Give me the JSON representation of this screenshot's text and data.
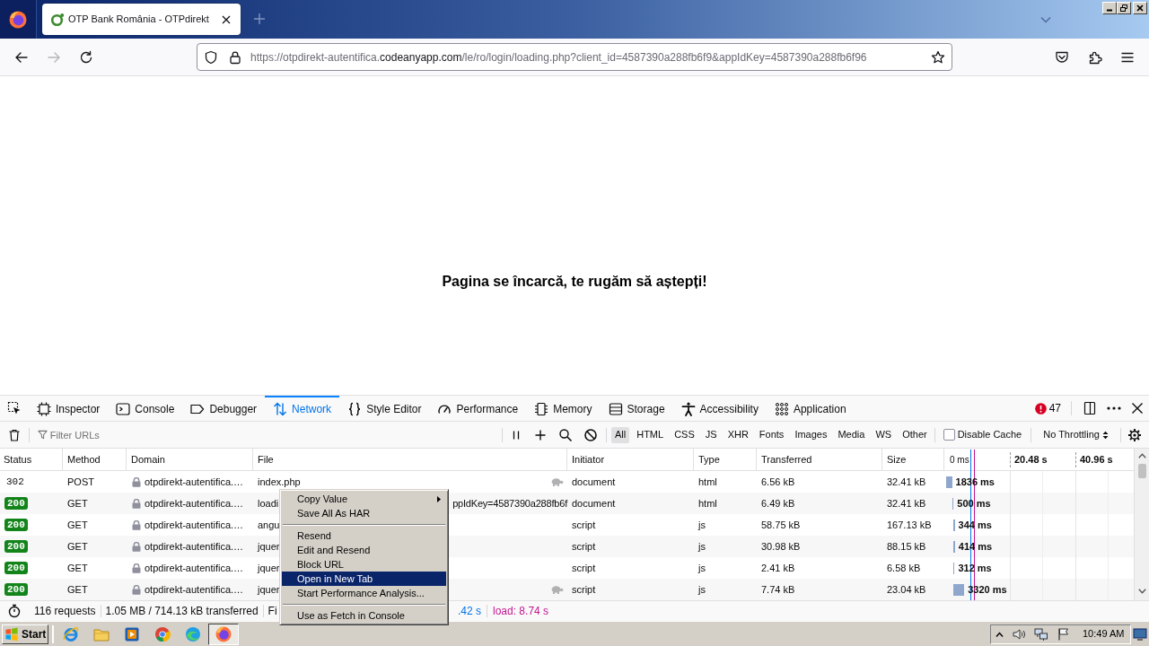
{
  "browser": {
    "tabs": [
      {
        "title": "OTP Bank România - OTPdirekt",
        "selected": true
      }
    ],
    "nav_buttons": [
      {
        "disabled": false
      },
      {
        "disabled": true
      },
      {
        "disabled": false
      }
    ],
    "url_parts": [
      {
        "text": "https://otpdirekt-autentifica.",
        "host": false
      },
      {
        "text": "codeanyapp.com",
        "host": true
      },
      {
        "text": "/le/ro/login/loading.php?client_id=4587390a288fb6f9&appIdKey=4587390a288fb6f96",
        "host": false
      }
    ]
  },
  "page": {
    "message": "Pagina se încarcă, te rugăm să aștepți!"
  },
  "devtools": {
    "tabs": [
      {
        "label": "Inspector",
        "selected": false
      },
      {
        "label": "Console",
        "selected": false
      },
      {
        "label": "Debugger",
        "selected": false
      },
      {
        "label": "Network",
        "selected": true
      },
      {
        "label": "Style Editor",
        "selected": false
      },
      {
        "label": "Performance",
        "selected": false
      },
      {
        "label": "Memory",
        "selected": false
      },
      {
        "label": "Storage",
        "selected": false
      },
      {
        "label": "Accessibility",
        "selected": false
      },
      {
        "label": "Application",
        "selected": false
      }
    ],
    "error_count": "47",
    "filter": {
      "placeholder": "Filter URLs"
    },
    "type_filters": [
      {
        "label": "All",
        "selected": true
      },
      {
        "label": "HTML",
        "selected": false
      },
      {
        "label": "CSS",
        "selected": false
      },
      {
        "label": "JS",
        "selected": false
      },
      {
        "label": "XHR",
        "selected": false
      },
      {
        "label": "Fonts",
        "selected": false
      },
      {
        "label": "Images",
        "selected": false
      },
      {
        "label": "Media",
        "selected": false
      },
      {
        "label": "WS",
        "selected": false
      },
      {
        "label": "Other",
        "selected": false
      }
    ],
    "disable_cache": {
      "label": "Disable Cache",
      "checked": false
    },
    "throttling": "No Throttling",
    "columns": [
      "Status",
      "Method",
      "Domain",
      "File",
      "Initiator",
      "Type",
      "Transferred",
      "Size"
    ],
    "waterfall_ticks": [
      "0 ms",
      "20.48 s",
      "40.96 s"
    ],
    "rows": [
      {
        "status": "302",
        "badge": false,
        "method": "POST",
        "domain": "otpdirekt-autentifica.…",
        "file": [
          "index.php"
        ],
        "slow": true,
        "initiator": "document",
        "type": "html",
        "transferred": "6.56 kB",
        "size": "32.41 kB",
        "time": "1836 ms"
      },
      {
        "status": "200",
        "badge": true,
        "method": "GET",
        "domain": "otpdirekt-autentifica.…",
        "file": [
          "loadi",
          "ppIdKey=4587390a288fb6f"
        ],
        "slow": false,
        "initiator": "document",
        "type": "html",
        "transferred": "6.49 kB",
        "size": "32.41 kB",
        "time": "500 ms"
      },
      {
        "status": "200",
        "badge": true,
        "method": "GET",
        "domain": "otpdirekt-autentifica.…",
        "file": [
          "angu"
        ],
        "slow": false,
        "initiator": "script",
        "type": "js",
        "transferred": "58.75 kB",
        "size": "167.13 kB",
        "time": "344 ms"
      },
      {
        "status": "200",
        "badge": true,
        "method": "GET",
        "domain": "otpdirekt-autentifica.…",
        "file": [
          "jquer"
        ],
        "slow": false,
        "initiator": "script",
        "type": "js",
        "transferred": "30.98 kB",
        "size": "88.15 kB",
        "time": "414 ms"
      },
      {
        "status": "200",
        "badge": true,
        "method": "GET",
        "domain": "otpdirekt-autentifica.…",
        "file": [
          "jquer"
        ],
        "slow": false,
        "initiator": "script",
        "type": "js",
        "transferred": "2.41 kB",
        "size": "6.58 kB",
        "time": "312 ms"
      },
      {
        "status": "200",
        "badge": true,
        "method": "GET",
        "domain": "otpdirekt-autentifica.…",
        "file": [
          "jquer"
        ],
        "slow": true,
        "initiator": "script",
        "type": "js",
        "transferred": "7.74 kB",
        "size": "23.04 kB",
        "time": "3320 ms"
      }
    ],
    "status_bar": {
      "requests": "116 requests",
      "transferred": "1.05 MB / 714.13 kB transferred",
      "finish": "Fi",
      "dom_content_loaded": ".42 s",
      "load": "load: 8.74 s"
    }
  },
  "context_menu": {
    "items": [
      {
        "kind": "item",
        "label": "Copy Value",
        "submenu": true,
        "selected": false
      },
      {
        "kind": "item",
        "label": "Save All As HAR",
        "submenu": false,
        "selected": false
      },
      {
        "kind": "separator"
      },
      {
        "kind": "item",
        "label": "Resend",
        "submenu": false,
        "selected": false
      },
      {
        "kind": "item",
        "label": "Edit and Resend",
        "submenu": false,
        "selected": false
      },
      {
        "kind": "item",
        "label": "Block URL",
        "submenu": false,
        "selected": false
      },
      {
        "kind": "item",
        "label": "Open in New Tab",
        "submenu": false,
        "selected": true
      },
      {
        "kind": "item",
        "label": "Start Performance Analysis...",
        "submenu": false,
        "selected": false
      },
      {
        "kind": "separator"
      },
      {
        "kind": "item",
        "label": "Use as Fetch in Console",
        "submenu": false,
        "selected": false
      }
    ]
  },
  "taskbar": {
    "start": "Start",
    "apps": [
      {
        "selected": false
      },
      {
        "selected": false
      },
      {
        "selected": false
      },
      {
        "selected": false
      },
      {
        "selected": false
      },
      {
        "selected": true
      }
    ],
    "clock": "10:49 AM"
  }
}
